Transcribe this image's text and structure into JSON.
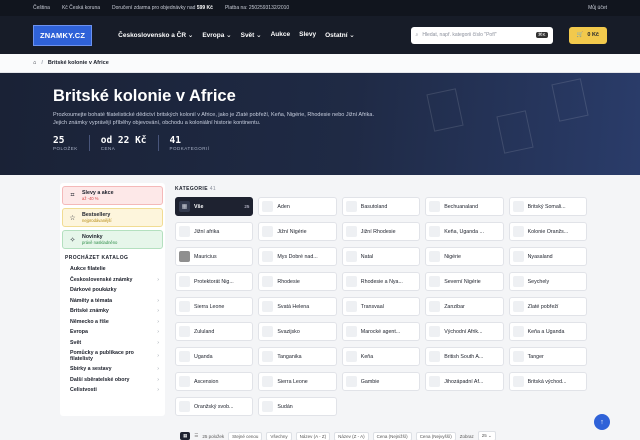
{
  "topbar": {
    "currency": "Čeština",
    "country": "Kč Česká koruna",
    "shipping_prefix": "Doručení zdarma pro objednávky nad",
    "shipping_amount": "599 Kč",
    "payment": "Platba na: 2502593132/2010",
    "account": "Můj účet"
  },
  "nav": {
    "logo": "ZNAMKY.CZ",
    "items": [
      {
        "label": "Československo a ČR ⌄"
      },
      {
        "label": "Evropa ⌄"
      },
      {
        "label": "Svět ⌄"
      },
      {
        "label": "Aukce"
      },
      {
        "label": "Slevy"
      },
      {
        "label": "Ostatní ⌄"
      }
    ],
    "search_placeholder": "Hledat, např. kategorii číslo \"Pofl\"",
    "search_shortcut": "⌘K",
    "cart_label": "0 Kč"
  },
  "breadcrumb": {
    "current": "Britské kolonie v Africe"
  },
  "hero": {
    "title": "Britské kolonie v Africe",
    "description": "Prozkoumejte bohaté filatelistické dědictví britských kolonií v Africe, jako je Zlaté pobřeží, Keňa, Nigérie, Rhodesie nebo Jižní Afrika. Jejich známky vyprávějí příběhy objevování, obchodu a koloniální historie kontinentu.",
    "stats": [
      {
        "value": "25",
        "label": "POLOŽEK"
      },
      {
        "value": "od 22 Kč",
        "label": "CENA"
      },
      {
        "value": "41",
        "label": "PODKATEGORIÍ"
      }
    ]
  },
  "sidebar": {
    "promos": [
      {
        "title": "Slevy a akce",
        "sub": "až -40 %",
        "icon": "tag-icon"
      },
      {
        "title": "Bestsellery",
        "sub": "nejprodávanější",
        "icon": "star-icon"
      },
      {
        "title": "Novinky",
        "sub": "právě naskladněno",
        "icon": "sparkle-icon"
      }
    ],
    "catalog_heading": "PROCHÁZET KATALOG",
    "items": [
      {
        "label": "Aukce filatelie",
        "arrow": ""
      },
      {
        "label": "Československé známky",
        "arrow": "›"
      },
      {
        "label": "Dárkové poukázky",
        "arrow": ""
      },
      {
        "label": "Náměty a témata",
        "arrow": "›"
      },
      {
        "label": "Britské známky",
        "arrow": "›"
      },
      {
        "label": "Německo a říše",
        "arrow": "›"
      },
      {
        "label": "Evropa",
        "arrow": "›"
      },
      {
        "label": "Svět",
        "arrow": "›"
      },
      {
        "label": "Pomůcky a publikace pro filatelisty",
        "arrow": "›"
      },
      {
        "label": "Sbírky a sestavy",
        "arrow": "›"
      },
      {
        "label": "Další sběratelské obory",
        "arrow": "›"
      },
      {
        "label": "Celistvosti",
        "arrow": "›"
      }
    ]
  },
  "categories": {
    "heading": "KATEGORIE",
    "count": "41",
    "items": [
      {
        "label": "Vše",
        "count": "25"
      },
      {
        "label": "Aden"
      },
      {
        "label": "Basutoland"
      },
      {
        "label": "Bechuanaland"
      },
      {
        "label": "Britský Somali..."
      },
      {
        "label": "Jižní afrika"
      },
      {
        "label": "Jižní Nigérie"
      },
      {
        "label": "Jižní Rhodesie"
      },
      {
        "label": "Keňa, Uganda ..."
      },
      {
        "label": "Kolonie Oranžs..."
      },
      {
        "label": "Mauricius"
      },
      {
        "label": "Mys Dobré nad..."
      },
      {
        "label": "Natal"
      },
      {
        "label": "Nigérie"
      },
      {
        "label": "Nyasaland"
      },
      {
        "label": "Protektorát Nig..."
      },
      {
        "label": "Rhodesie"
      },
      {
        "label": "Rhodesie a Nya..."
      },
      {
        "label": "Severní Nigérie"
      },
      {
        "label": "Seychely"
      },
      {
        "label": "Sierra Leone"
      },
      {
        "label": "Svatá Helena"
      },
      {
        "label": "Transvaal"
      },
      {
        "label": "Zanzibar"
      },
      {
        "label": "Zlaté pobřeží"
      },
      {
        "label": "Zululand"
      },
      {
        "label": "Svazijsko"
      },
      {
        "label": "Marocké agent..."
      },
      {
        "label": "Východní Afrik..."
      },
      {
        "label": "Keňa a Uganda"
      },
      {
        "label": "Uganda"
      },
      {
        "label": "Tanganika"
      },
      {
        "label": "Keňa"
      },
      {
        "label": "British South A..."
      },
      {
        "label": "Tanger"
      },
      {
        "label": "Ascension"
      },
      {
        "label": "Sierra Leone"
      },
      {
        "label": "Gambie"
      },
      {
        "label": "Jihozápadní Af..."
      },
      {
        "label": "Britská východ..."
      },
      {
        "label": "Oranžský svob..."
      },
      {
        "label": "Sudán"
      }
    ]
  },
  "toolbar": {
    "count_text": "25 položek",
    "sort_options": [
      "Stejné cenou",
      "Všechny",
      "Název (A - Z)",
      "Název (Z - A)",
      "Cena (Nejnižší)",
      "Cena (Nejvyšší)"
    ],
    "show_label": "Zobraz",
    "per_page": "25 ⌄"
  },
  "fab": {
    "icon": "arrow-up-icon"
  }
}
